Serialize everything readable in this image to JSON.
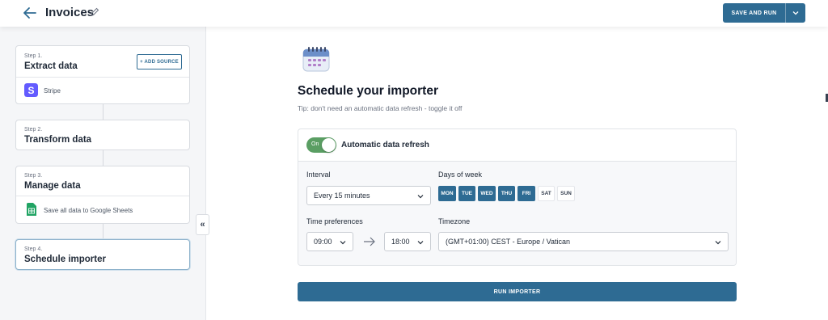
{
  "header": {
    "title": "Invoices",
    "save_run_label": "SAVE AND RUN",
    "accent": "#2e6b93"
  },
  "sidebar": {
    "steps": [
      {
        "label": "Step 1.",
        "title": "Extract data",
        "action": "+ ADD SOURCE",
        "item": "Stripe",
        "item_icon": "stripe-icon"
      },
      {
        "label": "Step 2.",
        "title": "Transform data"
      },
      {
        "label": "Step 3.",
        "title": "Manage data",
        "item": "Save all data to Google Sheets",
        "item_icon": "google-sheets-icon"
      },
      {
        "label": "Step 4.",
        "title": "Schedule importer"
      }
    ],
    "collapse_label": "«"
  },
  "main": {
    "heading": "Schedule your importer",
    "tip": "Tip: don't need an automatic data refresh - toggle it off",
    "toggle": {
      "state": "On",
      "label": "Automatic data refresh",
      "color": "#5a9e63"
    },
    "interval": {
      "label": "Interval",
      "value": "Every 15 minutes"
    },
    "days": {
      "label": "Days of week",
      "items": [
        {
          "name": "MON",
          "selected": true
        },
        {
          "name": "TUE",
          "selected": true
        },
        {
          "name": "WED",
          "selected": true
        },
        {
          "name": "THU",
          "selected": true
        },
        {
          "name": "FRI",
          "selected": true
        },
        {
          "name": "SAT",
          "selected": false
        },
        {
          "name": "SUN",
          "selected": false
        }
      ]
    },
    "time": {
      "label": "Time preferences",
      "from": "09:00",
      "to": "18:00"
    },
    "timezone": {
      "label": "Timezone",
      "value": "(GMT+01:00) CEST - Europe / Vatican"
    },
    "run_label": "RUN IMPORTER"
  }
}
